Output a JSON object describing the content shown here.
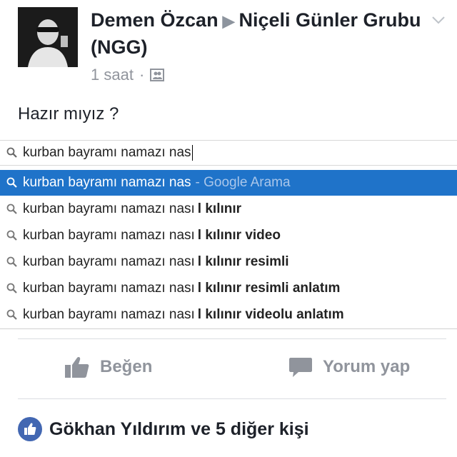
{
  "post": {
    "author": "Demen Özcan",
    "group": "Niçeli Günler Grubu (NGG)",
    "time": "1 saat",
    "separator": "·",
    "text": "Hazır mıyız ?"
  },
  "search": {
    "query": "kurban bayramı namazı nas"
  },
  "suggestions": [
    {
      "prefix": "kurban bayramı namazı nas",
      "bold": "",
      "hint": "- Google Arama",
      "active": true
    },
    {
      "prefix": "kurban bayramı namazı nası",
      "bold": "l kılınır",
      "hint": "",
      "active": false
    },
    {
      "prefix": "kurban bayramı namazı nası",
      "bold": "l kılınır video",
      "hint": "",
      "active": false
    },
    {
      "prefix": "kurban bayramı namazı nası",
      "bold": "l kılınır resimli",
      "hint": "",
      "active": false
    },
    {
      "prefix": "kurban bayramı namazı nası",
      "bold": "l kılınır resimli anlatım",
      "hint": "",
      "active": false
    },
    {
      "prefix": "kurban bayramı namazı nası",
      "bold": "l kılınır videolu anlatım",
      "hint": "",
      "active": false
    }
  ],
  "actions": {
    "like_label": "Beğen",
    "comment_label": "Yorum yap"
  },
  "reactions": {
    "summary": "Gökhan Yıldırım ve 5 diğer kişi"
  },
  "colors": {
    "highlight": "#1f73c9",
    "facebook_blue": "#4267b2",
    "muted": "#90949c"
  }
}
